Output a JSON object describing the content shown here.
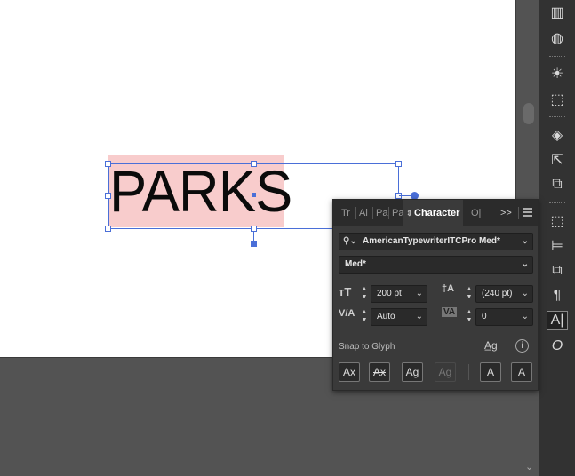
{
  "canvas": {
    "text_object": "PARKS"
  },
  "character_panel": {
    "tabs": [
      "Tr",
      "Al",
      "Pa",
      "Pa",
      "Character",
      "O|"
    ],
    "active_tab": "Character",
    "overflow_label": ">>",
    "font_family": "AmericanTypewriterITCPro Med*",
    "font_style": "Med*",
    "font_size": "200 pt",
    "leading": "(240 pt)",
    "kerning": "Auto",
    "tracking": "0",
    "snap_to_glyph_label": "Snap to Glyph",
    "info_label": "i",
    "glyph_buttons": [
      "Ax",
      "Ax",
      "Ag",
      "Ag",
      "A",
      "A"
    ]
  },
  "toolbar": {
    "items": [
      "gradient",
      "shape-builder",
      "sun-symbol",
      "export",
      "layers",
      "export-share",
      "pathfinder",
      "transform",
      "align",
      "pathfinder-2",
      "paragraph",
      "character",
      "opentype"
    ]
  },
  "colors": {
    "selection": "#4a6fd8",
    "highlight": "#f8cccc",
    "panel_bg": "#3a3a3a",
    "pasteboard": "#535353"
  }
}
